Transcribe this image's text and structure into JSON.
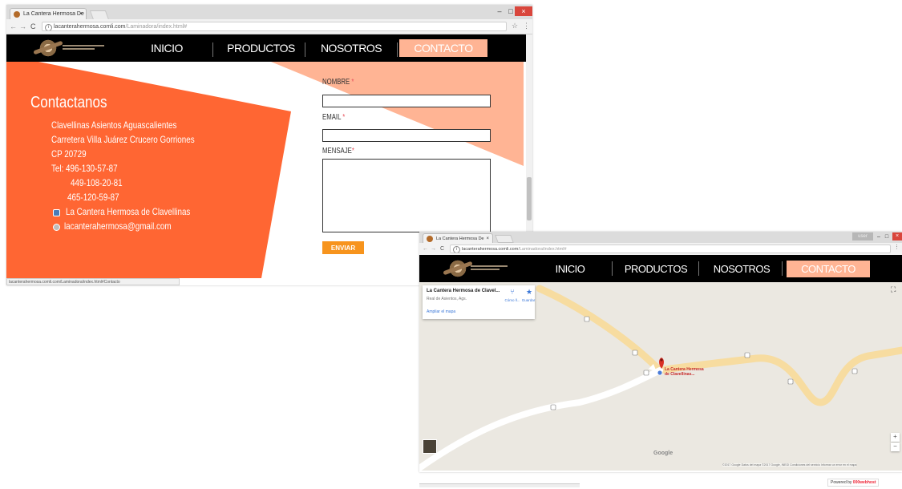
{
  "window1": {
    "tab_title": "La Cantera Hermosa De",
    "tab_close": "×",
    "controls": {
      "minimize": "–",
      "maximize": "□",
      "close": "×"
    },
    "nav": {
      "back": "←",
      "forward": "→",
      "reload": "C"
    },
    "url_info": "i",
    "url_host": "lacanterahermosa.comli.com",
    "url_path": "/Laminadora/index.html#",
    "star": "☆",
    "menu": "⋮",
    "site_nav": [
      "INICIO",
      "PRODUCTOS",
      "NOSOTROS",
      "CONTACTO"
    ],
    "contact": {
      "title": "Contactanos",
      "lines": [
        "Clavellinas Asientos Aguascalientes",
        "Carretera Villa Juárez Crucero Gorriones",
        "CP 20729",
        "Tel:  496-130-57-87",
        "449-108-20-81",
        "465-120-59-87",
        "La Cantera Hermosa de Clavellinas",
        "lacanterahermosa@gmail.com"
      ]
    },
    "form": {
      "name_label": "NOMBRE",
      "email_label": "EMAIL",
      "message_label": "MENSAJE",
      "required_mark": "*",
      "send": "ENVIAR"
    },
    "status_url": "lacanterahermosa.comli.com/Laminadora/index.html#Contacto"
  },
  "window2": {
    "tab_title": "La Cantera Hermosa De",
    "tab_close": "×",
    "controls": {
      "user": "user",
      "minimize": "–",
      "maximize": "□",
      "close": "×"
    },
    "nav": {
      "back": "←",
      "forward": "→",
      "reload": "C"
    },
    "url_info": "i",
    "url_host": "lacanterahermosa.comli.com",
    "url_path": "/Laminadora/index.html#",
    "menu": "⋮",
    "site_nav": [
      "INICIO",
      "PRODUCTOS",
      "NOSOTROS",
      "CONTACTO"
    ],
    "map": {
      "place_title": "La Cantera Hermosa de Clavel...",
      "place_sub": "Real de Asientos, Ags.",
      "enlarge": "Ampliar el mapa",
      "directions": "Cómo ll...",
      "save": "Guardar",
      "pin_label": "La Cantera Hermosa\nde Clavellinas...",
      "zoom_in": "+",
      "zoom_out": "−",
      "google": "Google",
      "terms": "©2017 Google   Datos del mapa ©2017 Google, INEGI   Condiciones del servicio   Informar un error en el mapa"
    },
    "powered_by": "Powered by",
    "powered_brand": "000webhost"
  },
  "colors": {
    "orange": "#ff6633",
    "peach": "#ffb494",
    "send": "#f7941d",
    "road": "#f7dca0"
  }
}
